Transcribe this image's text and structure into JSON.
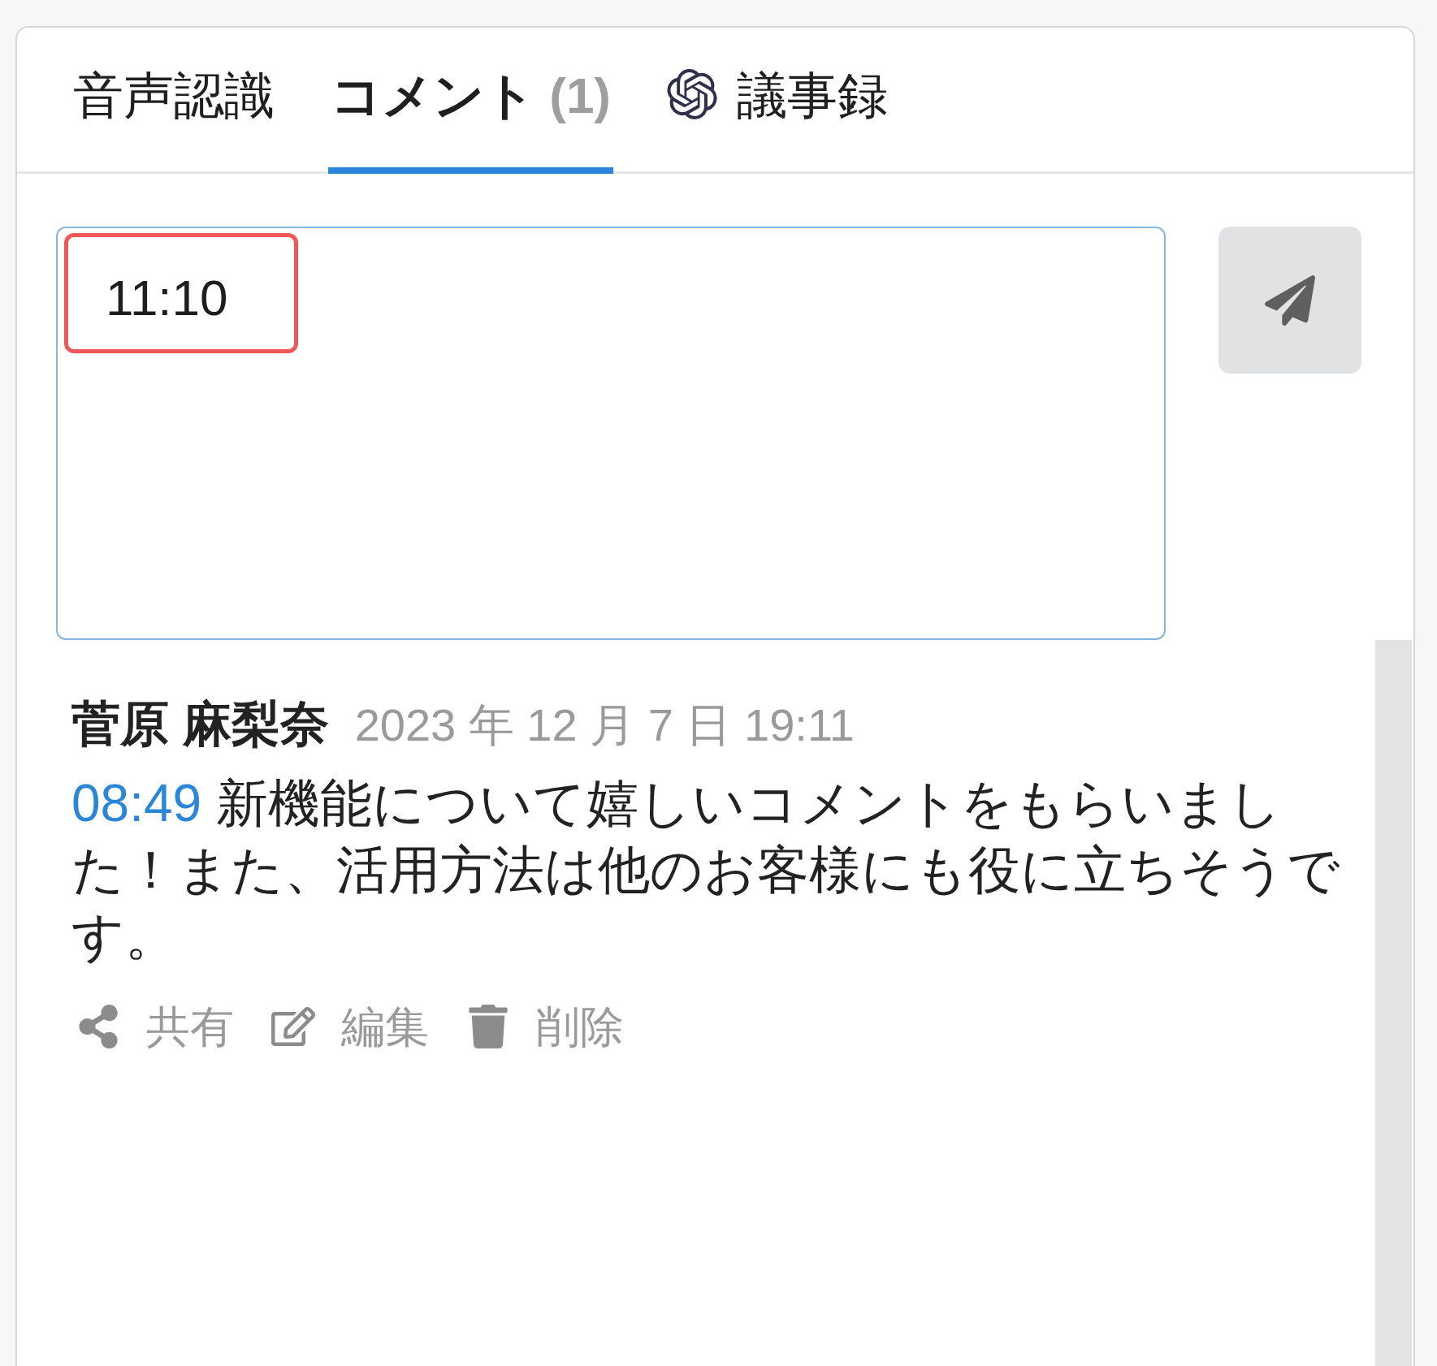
{
  "tabs": [
    {
      "label": "音声認識",
      "kind": "plain",
      "selected": false
    },
    {
      "label": "コメント",
      "count": "(1)",
      "kind": "plain",
      "selected": true
    },
    {
      "label": "議事録",
      "kind": "ai",
      "selected": false
    }
  ],
  "comment_input": {
    "value": "11:10",
    "highlighted": true
  },
  "comments": [
    {
      "author": "菅原 麻梨奈",
      "date": "2023 年 12 月 7 日 19:11",
      "timestamp": "08:49",
      "text": "新機能について嬉しいコメントをもらいました！また、活用方法は他のお客様にも役に立ちそうです。",
      "actions": [
        {
          "kind": "share",
          "label": "共有"
        },
        {
          "kind": "edit",
          "label": "編集"
        },
        {
          "kind": "delete",
          "label": "削除"
        }
      ]
    }
  ]
}
